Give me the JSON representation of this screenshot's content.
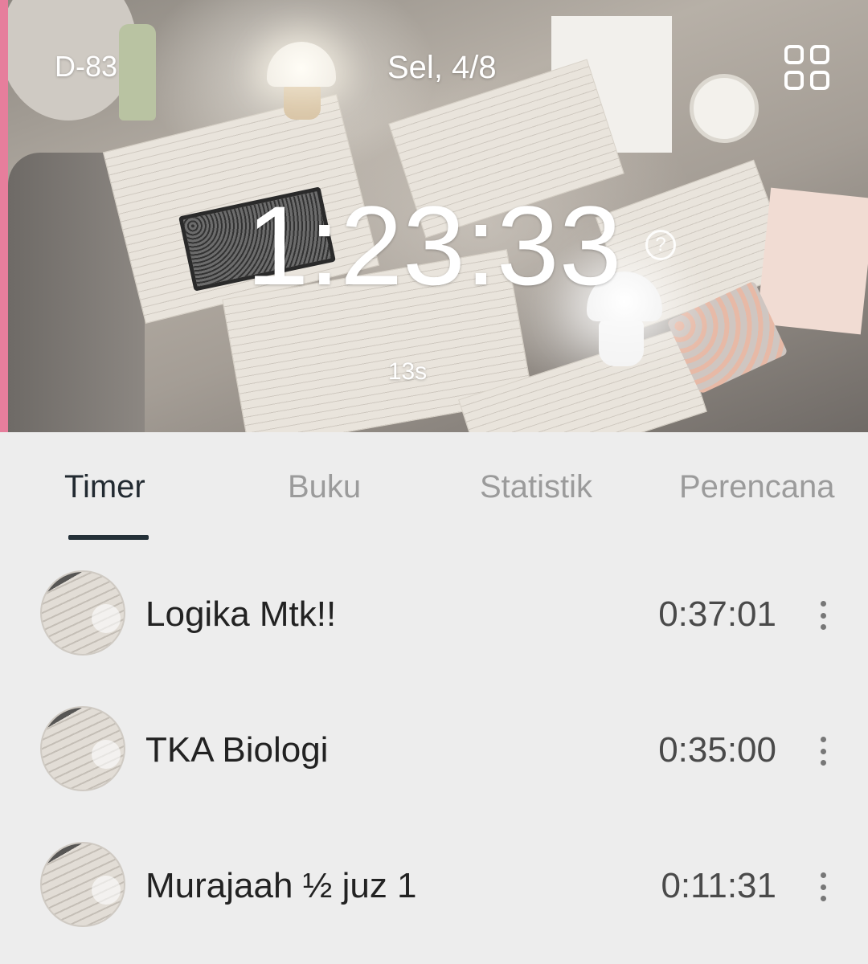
{
  "header": {
    "dday": "D-83",
    "date": "Sel, 4/8",
    "timer": "1:23:33",
    "seconds": "13s",
    "accent_color": "#e67e9c",
    "grid_icon": "grid-icon",
    "help_icon": "help-circle-icon",
    "help_glyph": "?"
  },
  "tabs": [
    {
      "label": "Timer",
      "active": true
    },
    {
      "label": "Buku",
      "active": false
    },
    {
      "label": "Statistik",
      "active": false
    },
    {
      "label": "Perencana",
      "active": false
    }
  ],
  "subjects": [
    {
      "name": "Logika Mtk!!",
      "time": "0:37:01",
      "icon": "more-vertical-icon"
    },
    {
      "name": "TKA Biologi",
      "time": "0:35:00",
      "icon": "more-vertical-icon"
    },
    {
      "name": "Murajaah ½ juz 1",
      "time": "0:11:31",
      "icon": "more-vertical-icon"
    }
  ]
}
